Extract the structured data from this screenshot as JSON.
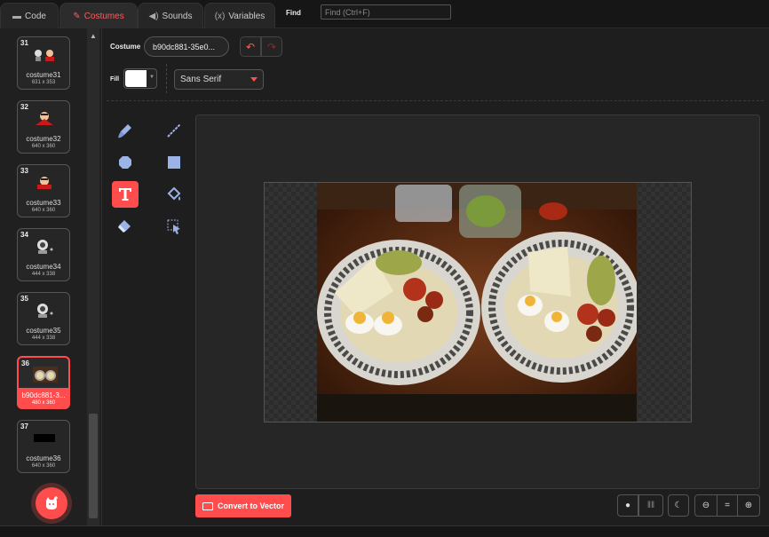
{
  "tabs": [
    {
      "label": "Code",
      "icon": "code-icon"
    },
    {
      "label": "Costumes",
      "icon": "brush-icon"
    },
    {
      "label": "Sounds",
      "icon": "speaker-icon"
    },
    {
      "label": "Variables",
      "icon": "variables-icon"
    }
  ],
  "tab_icons": {
    "variables": "(x)"
  },
  "find": {
    "label": "Find",
    "placeholder": "Find (Ctrl+F)"
  },
  "costumes": [
    {
      "num": "31",
      "name": "costume31",
      "size": "631 x 353"
    },
    {
      "num": "32",
      "name": "costume32",
      "size": "640 x 360"
    },
    {
      "num": "33",
      "name": "costume33",
      "size": "640 x 360"
    },
    {
      "num": "34",
      "name": "costume34",
      "size": "444 x 338"
    },
    {
      "num": "35",
      "name": "costume35",
      "size": "444 x 338"
    },
    {
      "num": "36",
      "name": "b90dc881-3...",
      "size": "480 x 360",
      "selected": true
    },
    {
      "num": "37",
      "name": "costume36",
      "size": "640 x 360"
    }
  ],
  "editor": {
    "costume_label": "Costume",
    "costume_name": "b90dc881-35e0...",
    "fill_label": "Fill",
    "fill_color": "#ffffff",
    "font": "Sans Serif",
    "convert_button": "Convert to Vector",
    "zoom_reset": "="
  },
  "colors": {
    "accent": "#ff4c4c",
    "background": "#1e1e1e"
  }
}
